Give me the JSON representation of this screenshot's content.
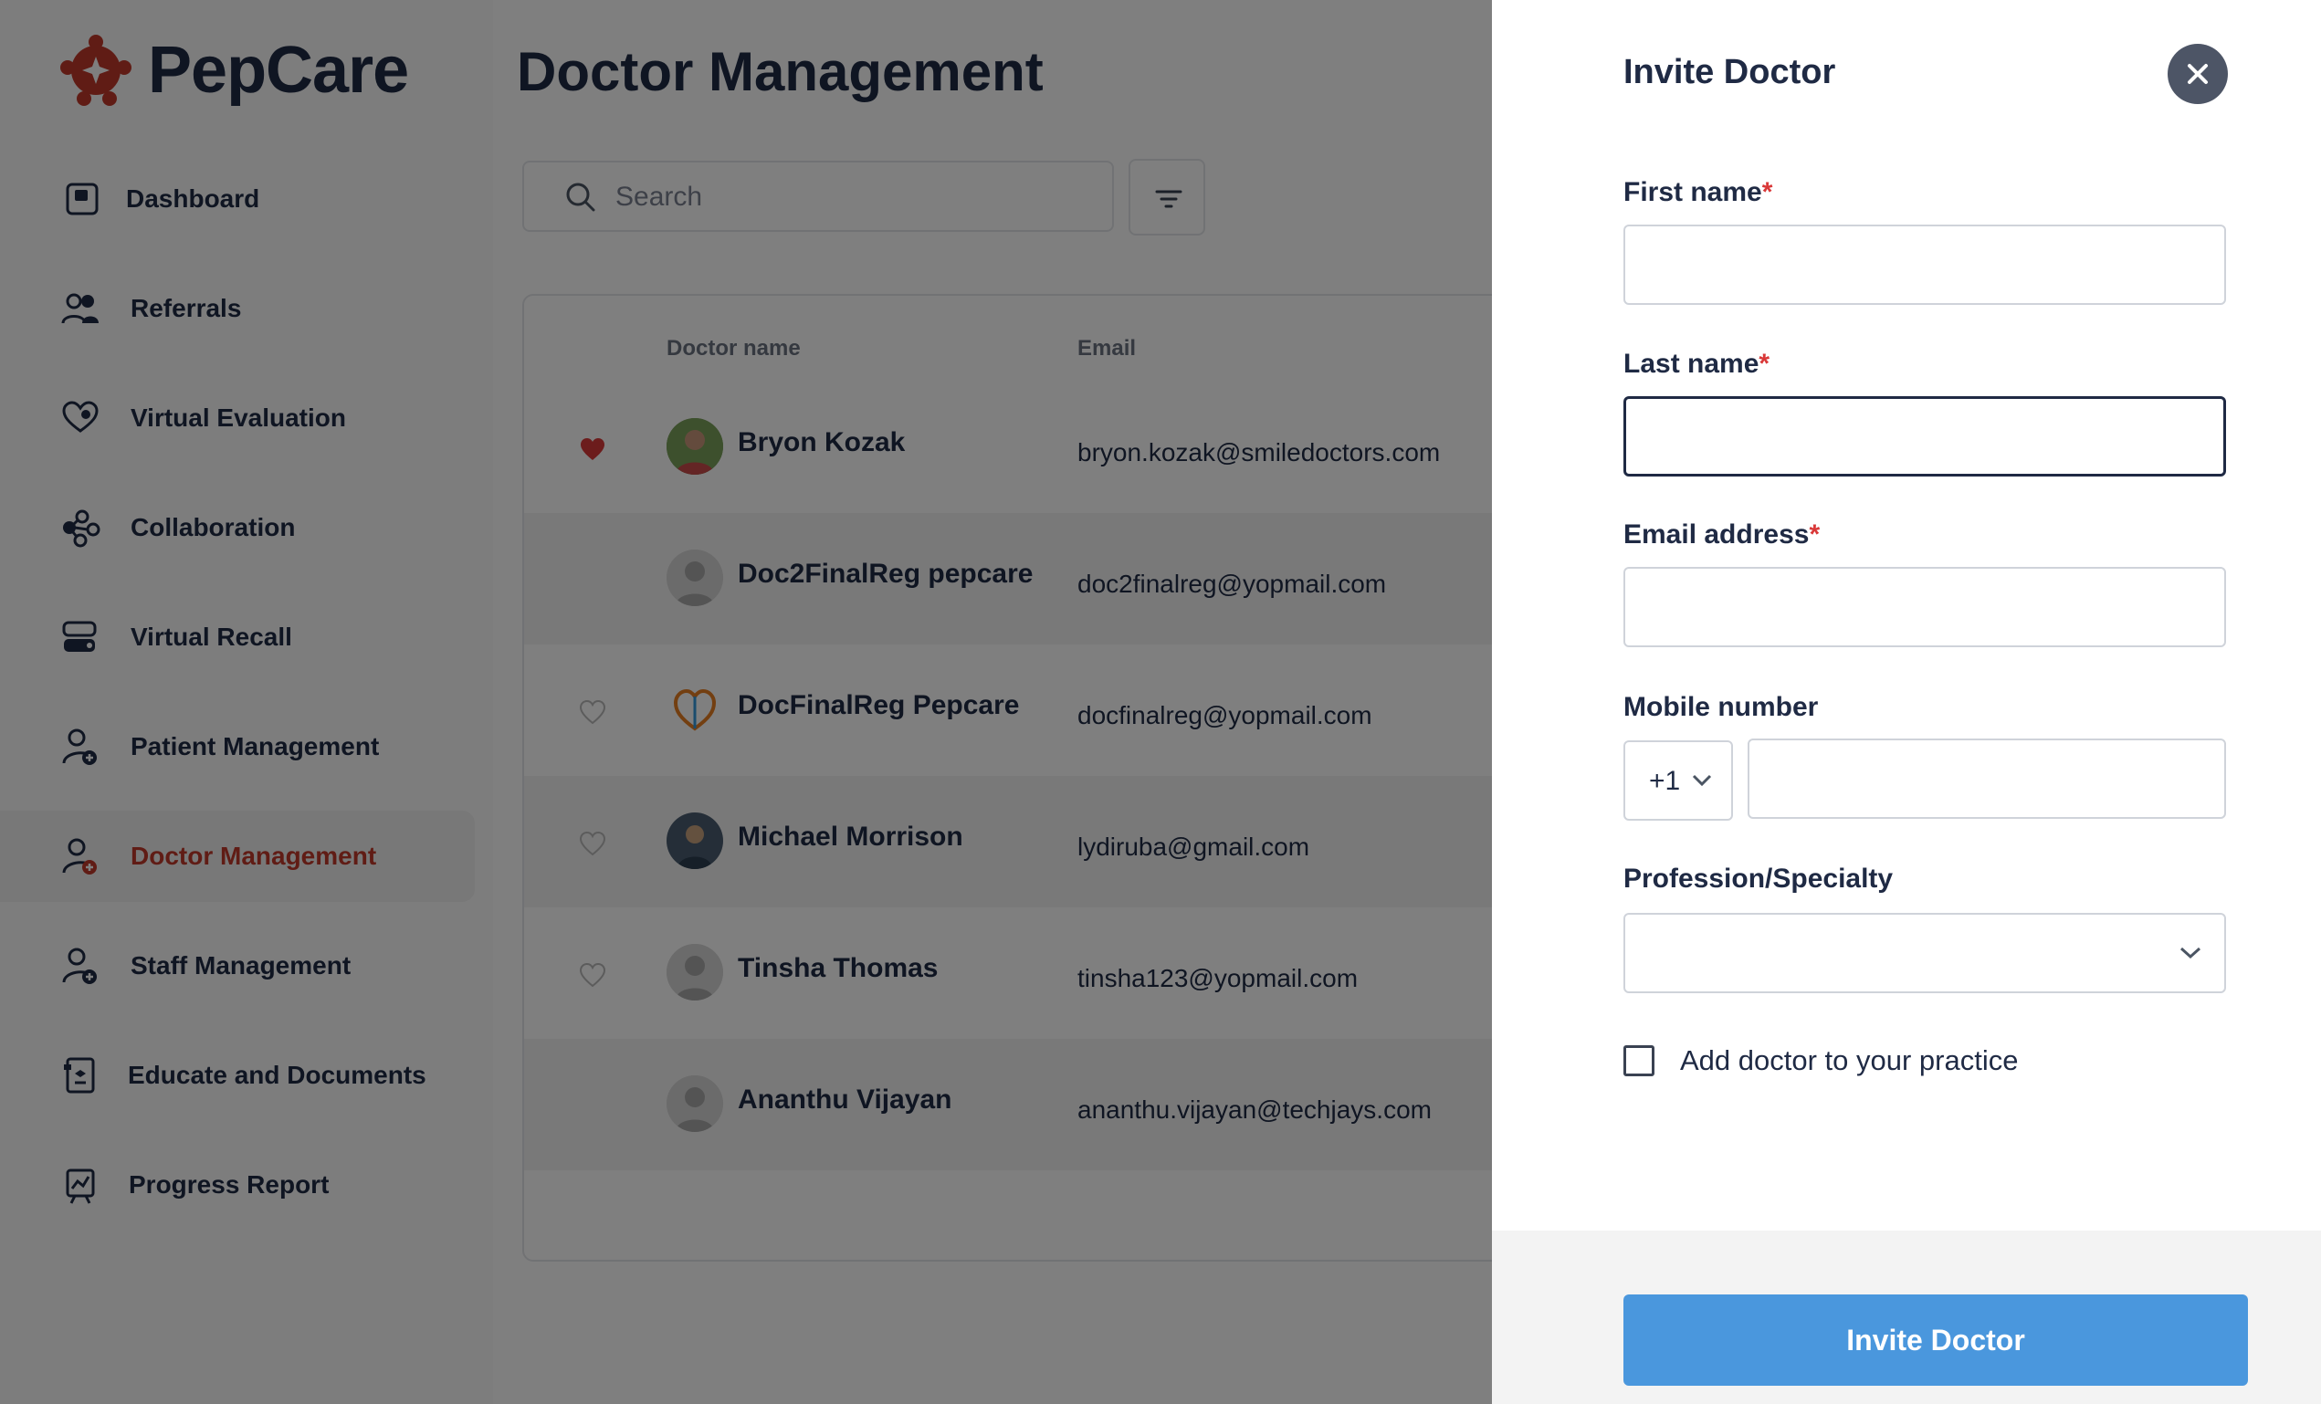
{
  "app": {
    "brand": "PepCare",
    "page_title": "Doctor Management"
  },
  "sidebar": {
    "items": [
      {
        "label": "Dashboard",
        "icon": "dashboard-icon",
        "active": false
      },
      {
        "label": "Referrals",
        "icon": "users-icon",
        "active": false
      },
      {
        "label": "Virtual Evaluation",
        "icon": "heart-hand-icon",
        "active": false
      },
      {
        "label": "Collaboration",
        "icon": "network-icon",
        "active": false
      },
      {
        "label": "Virtual Recall",
        "icon": "recall-icon",
        "active": false
      },
      {
        "label": "Patient Management",
        "icon": "user-plus-icon",
        "active": false
      },
      {
        "label": "Doctor Management",
        "icon": "doctor-icon",
        "active": true
      },
      {
        "label": "Staff Management",
        "icon": "user-plus-icon",
        "active": false
      },
      {
        "label": "Educate and Documents",
        "icon": "document-icon",
        "active": false
      },
      {
        "label": "Progress Report",
        "icon": "chart-icon",
        "active": false
      }
    ]
  },
  "search": {
    "placeholder": "Search",
    "value": ""
  },
  "table": {
    "columns": [
      "Doctor name",
      "Email"
    ],
    "rows": [
      {
        "name": "Bryon Kozak",
        "email": "bryon.kozak@smiledoctors.com",
        "favorite": true
      },
      {
        "name": "Doc2FinalReg pepcare",
        "email": "doc2finalreg@yopmail.com",
        "favorite": false
      },
      {
        "name": "DocFinalReg Pepcare",
        "email": "docfinalreg@yopmail.com",
        "favorite": false
      },
      {
        "name": "Michael Morrison",
        "email": "lydiruba@gmail.com",
        "favorite": false
      },
      {
        "name": "Tinsha Thomas",
        "email": "tinsha123@yopmail.com",
        "favorite": false
      },
      {
        "name": "Ananthu Vijayan",
        "email": "ananthu.vijayan@techjays.com",
        "favorite": false
      }
    ]
  },
  "drawer": {
    "title": "Invite Doctor",
    "fields": {
      "first_name": {
        "label": "First name",
        "required_mark": "*",
        "value": ""
      },
      "last_name": {
        "label": "Last name",
        "required_mark": "*",
        "value": ""
      },
      "email": {
        "label": "Email address",
        "required_mark": "*",
        "value": ""
      },
      "mobile": {
        "label": "Mobile number",
        "country_code": "+1",
        "value": ""
      },
      "specialty": {
        "label": "Profession/Specialty",
        "value": ""
      }
    },
    "checkbox_label": "Add doctor to your practice",
    "checkbox_checked": false,
    "submit_label": "Invite Doctor"
  },
  "colors": {
    "brand_red": "#c0392b",
    "primary_text": "#1f2a44",
    "button_blue": "#4a97dd",
    "required_red": "#d93838"
  }
}
